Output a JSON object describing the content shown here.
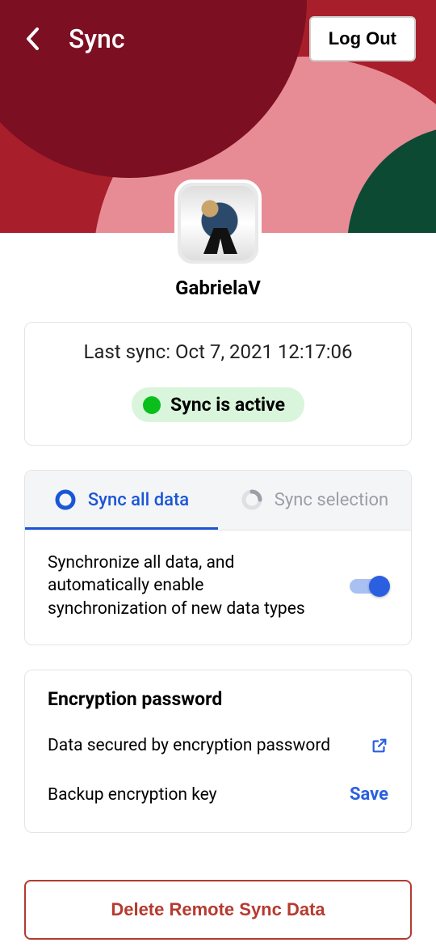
{
  "header": {
    "title": "Sync",
    "logout_label": "Log Out"
  },
  "user": {
    "name": "GabrielaV"
  },
  "sync_status": {
    "last_sync_label": "Last sync: Oct 7, 2021 12:17:06",
    "badge_text": "Sync is active",
    "status_color": "#0abf1c"
  },
  "tabs": {
    "all": {
      "label": "Sync all data",
      "active": true
    },
    "selection": {
      "label": "Sync selection",
      "active": false
    },
    "all_description": "Synchronize all data, and automatically enable synchronization of new data types",
    "toggle_on": true
  },
  "encryption": {
    "title": "Encryption password",
    "secured_label": "Data secured by encryption password",
    "backup_label": "Backup encryption key",
    "save_label": "Save"
  },
  "delete": {
    "label": "Delete Remote Sync Data"
  },
  "colors": {
    "accent": "#2a5fe0",
    "danger": "#b63a30"
  }
}
